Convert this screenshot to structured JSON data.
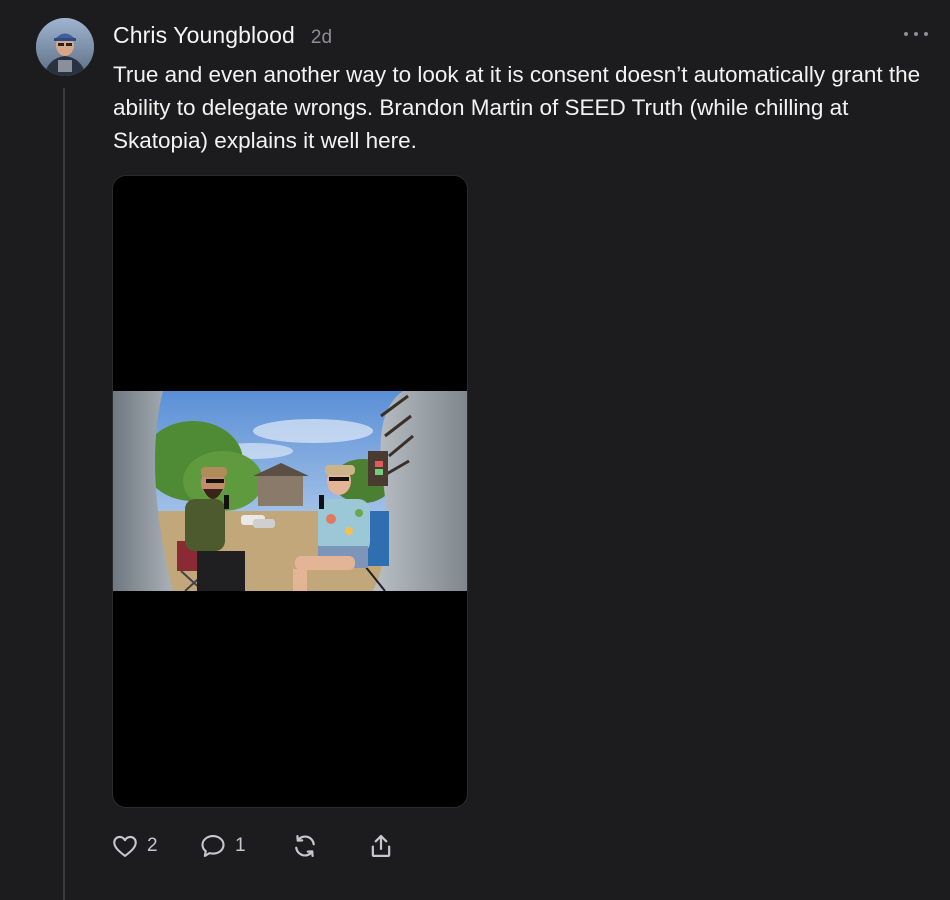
{
  "post": {
    "author": "Chris Youngblood",
    "timestamp": "2d",
    "text": "True and even another way to look at it is consent doesn’t automatically grant the ability to delegate wrongs. Brandon Martin of SEED Truth (while chilling at Skatopia) explains it well here."
  },
  "actions": {
    "like_count": "2",
    "reply_count": "1"
  },
  "icons": {
    "like": "heart-icon",
    "reply": "speech-bubble-icon",
    "repost": "repost-icon",
    "share": "share-icon",
    "more": "more-horizontal-icon"
  },
  "colors": {
    "background": "#1c1c1e",
    "text": "#f2f2f2",
    "muted": "#8e8e93"
  }
}
